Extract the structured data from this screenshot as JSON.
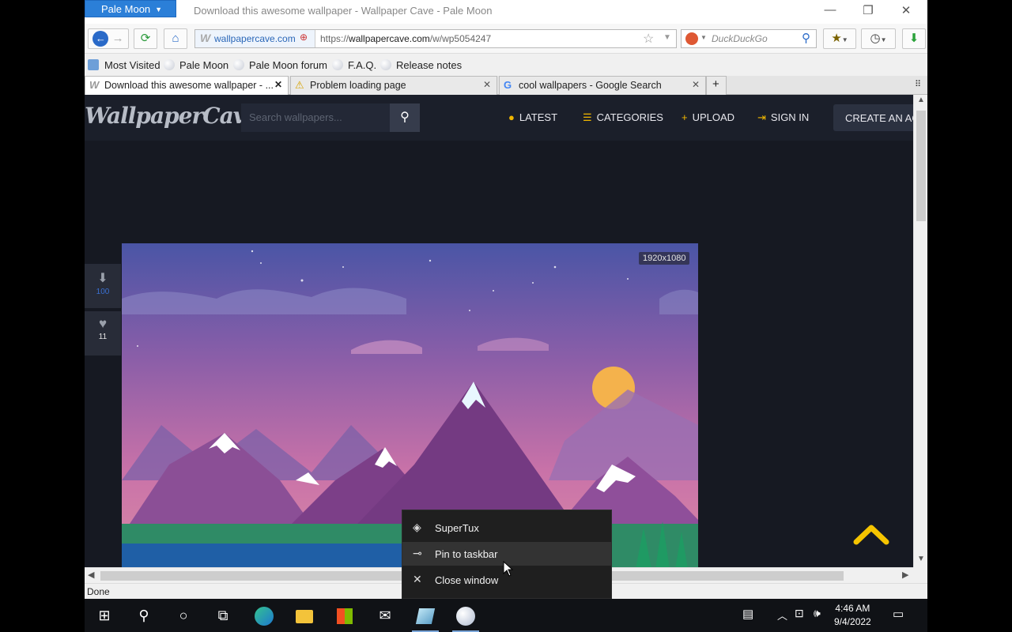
{
  "window": {
    "app_menu_label": "Pale Moon",
    "title": "Download this awesome wallpaper - Wallpaper Cave - Pale Moon",
    "controls": {
      "minimize": "—",
      "restore": "❐",
      "close": "✕"
    }
  },
  "navbar": {
    "identity_domain": "wallpapercave.com",
    "url_prefix": "https://",
    "url_host": "wallpapercave.com",
    "url_path": "/w/wp5054247",
    "search_engine_placeholder": "DuckDuckGo"
  },
  "bookmarks": [
    {
      "label": "Most Visited",
      "icon": "most-visited-icon"
    },
    {
      "label": "Pale Moon",
      "icon": "globe-icon"
    },
    {
      "label": "Pale Moon forum",
      "icon": "globe-icon"
    },
    {
      "label": "F.A.Q.",
      "icon": "globe-icon"
    },
    {
      "label": "Release notes",
      "icon": "globe-icon"
    }
  ],
  "tabs": [
    {
      "label": "Download this awesome wallpaper - ...",
      "icon": "wallpapercave-favicon",
      "active": true
    },
    {
      "label": "Problem loading page",
      "icon": "warning-icon",
      "active": false
    },
    {
      "label": "cool wallpapers - Google Search",
      "icon": "google-favicon",
      "active": false
    }
  ],
  "site": {
    "logo": "WallpaperCave",
    "search_placeholder": "Search wallpapers...",
    "nav": [
      {
        "label": "LATEST",
        "icon": "clock-icon"
      },
      {
        "label": "CATEGORIES",
        "icon": "list-icon"
      },
      {
        "label": "UPLOAD",
        "icon": "plus-icon"
      },
      {
        "label": "SIGN IN",
        "icon": "sign-in-icon"
      }
    ],
    "create_account_label": "CREATE AN AC",
    "resolution": "1920x1080",
    "download_count": "100",
    "like_count": "11"
  },
  "status": "Done",
  "jumplist": [
    {
      "label": "SuperTux",
      "icon": "supertux-icon"
    },
    {
      "label": "Pin to taskbar",
      "icon": "pin-icon"
    },
    {
      "label": "Close window",
      "icon": "close-icon"
    }
  ],
  "clock": {
    "time": "4:46 AM",
    "date": "9/4/2022"
  },
  "colors": {
    "accent": "#2b7fd8",
    "site_bg": "#161922",
    "highlight": "#f5c400"
  }
}
